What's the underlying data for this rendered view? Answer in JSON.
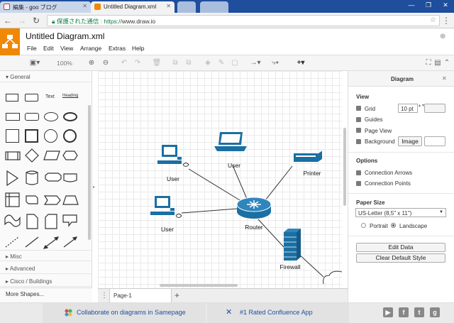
{
  "browser": {
    "tabs": [
      {
        "title": "編集 - goo ブログ"
      },
      {
        "title": "Untitled Diagram.xml"
      }
    ],
    "address": {
      "secure_label": "保護された通信",
      "url_scheme": "https://",
      "url_host": "www.draw.io"
    }
  },
  "app": {
    "title": "Untitled Diagram.xml",
    "menu": [
      "File",
      "Edit",
      "View",
      "Arrange",
      "Extras",
      "Help"
    ],
    "toolbar": {
      "zoom": "100%"
    }
  },
  "left_panel": {
    "general_label": "General",
    "text_shape_label": "Text",
    "heading_shape_label": "Heading",
    "sections": [
      "Misc",
      "Advanced",
      "Cisco / Buildings"
    ],
    "more_shapes": "More Shapes..."
  },
  "diagram": {
    "labels": {
      "user_top": "User",
      "user_left": "User",
      "user_bottom": "User",
      "printer": "Printer",
      "router": "Router",
      "firewall": "Firewall"
    }
  },
  "page_tab": {
    "label": "Page-1"
  },
  "right_panel": {
    "title": "Diagram",
    "view_header": "View",
    "grid_label": "Grid",
    "grid_size": "10 pt",
    "guides_label": "Guides",
    "page_view_label": "Page View",
    "background_label": "Background",
    "image_button": "Image",
    "options_header": "Options",
    "connection_arrows": "Connection Arrows",
    "connection_points": "Connection Points",
    "paper_size_header": "Paper Size",
    "paper_size_value": "US-Letter (8,5\" x 11\")",
    "portrait_label": "Portrait",
    "landscape_label": "Landscape",
    "orientation": "Landscape",
    "edit_data": "Edit Data",
    "clear_default_style": "Clear Default Style"
  },
  "footer": {
    "samepage": "Collaborate on diagrams in Samepage",
    "confluence": "#1 Rated Confluence App",
    "social": [
      "youtube-icon",
      "facebook-icon",
      "twitter-icon",
      "google-plus-icon"
    ]
  },
  "colors": {
    "brand": "#f08705",
    "icon_blue": "#1a6fa3",
    "chrome_blue": "#1e4e9c",
    "secure_green": "#0b8043"
  }
}
